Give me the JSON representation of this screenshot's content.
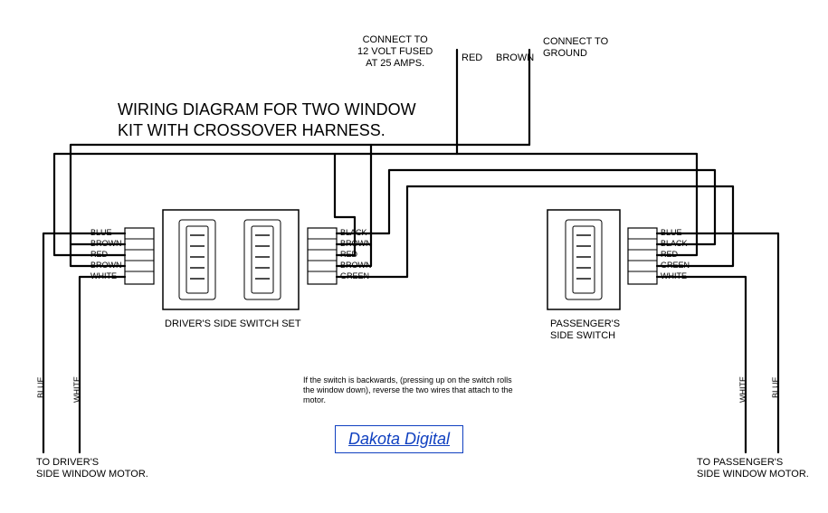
{
  "title": "WIRING DIAGRAM FOR TWO WINDOW\nKIT WITH CROSSOVER HARNESS.",
  "top_connect_left": "CONNECT TO\n12 VOLT FUSED\nAT 25 AMPS.",
  "top_connect_right": "CONNECT TO\nGROUND",
  "top_wire_red": "RED",
  "top_wire_brown": "BROWN",
  "driver_left_pins": [
    "BLUE",
    "BROWN",
    "RED",
    "BROWN",
    "WHITE"
  ],
  "driver_right_pins": [
    "BLACK",
    "BROWN",
    "RED",
    "BROWN",
    "GREEN"
  ],
  "passenger_pins": [
    "BLUE",
    "BLACK",
    "RED",
    "GREEN",
    "WHITE"
  ],
  "driver_switch_label": "DRIVER'S SIDE SWITCH SET",
  "passenger_switch_label": "PASSENGER'S\nSIDE SWITCH",
  "driver_motor_label": "TO DRIVER'S\nSIDE WINDOW MOTOR.",
  "passenger_motor_label": "TO PASSENGER'S\nSIDE WINDOW MOTOR.",
  "motor_wire_blue": "BLUE",
  "motor_wire_white": "WHITE",
  "note": "If the switch is backwards, (pressing up on the\nswitch rolls the window down), reverse the two\nwires that attach to the motor.",
  "brand": "Dakota Digital",
  "chart_data": {
    "type": "diagram",
    "title": "Wiring diagram for two window kit with crossover harness",
    "components": [
      {
        "id": "driver_switch_L",
        "label": "Driver's side switch (left rocker)",
        "pins_left": [
          "BLUE",
          "BROWN",
          "RED",
          "BROWN",
          "WHITE"
        ]
      },
      {
        "id": "driver_switch_R",
        "label": "Driver's side switch (right rocker)",
        "pins_right": [
          "BLACK",
          "BROWN",
          "RED",
          "BROWN",
          "GREEN"
        ]
      },
      {
        "id": "passenger_switch",
        "label": "Passenger's side switch",
        "pins_right": [
          "BLUE",
          "BLACK",
          "RED",
          "GREEN",
          "WHITE"
        ]
      },
      {
        "id": "driver_motor",
        "label": "Driver's side window motor"
      },
      {
        "id": "passenger_motor",
        "label": "Passenger's side window motor"
      },
      {
        "id": "power_12v",
        "label": "12V fused at 25A"
      },
      {
        "id": "ground",
        "label": "Ground"
      }
    ],
    "wires": [
      {
        "color": "RED",
        "from": "power_12v",
        "to": [
          "driver_switch_L:RED",
          "driver_switch_R:RED",
          "passenger_switch:RED"
        ]
      },
      {
        "color": "BROWN",
        "from": "ground",
        "to": [
          "driver_switch_L:BROWN(upper)",
          "driver_switch_L:BROWN(lower)",
          "driver_switch_R:BROWN(upper)",
          "driver_switch_R:BROWN(lower)"
        ]
      },
      {
        "color": "BLUE",
        "from": "driver_switch_L:BLUE",
        "to": "driver_motor"
      },
      {
        "color": "WHITE",
        "from": "driver_switch_L:WHITE",
        "to": "driver_motor"
      },
      {
        "color": "BLACK",
        "from": "driver_switch_R:BLACK",
        "to": "passenger_switch:BLACK"
      },
      {
        "color": "GREEN",
        "from": "driver_switch_R:GREEN",
        "to": "passenger_switch:GREEN"
      },
      {
        "color": "BLUE",
        "from": "passenger_switch:BLUE",
        "to": "passenger_motor"
      },
      {
        "color": "WHITE",
        "from": "passenger_switch:WHITE",
        "to": "passenger_motor"
      }
    ]
  }
}
